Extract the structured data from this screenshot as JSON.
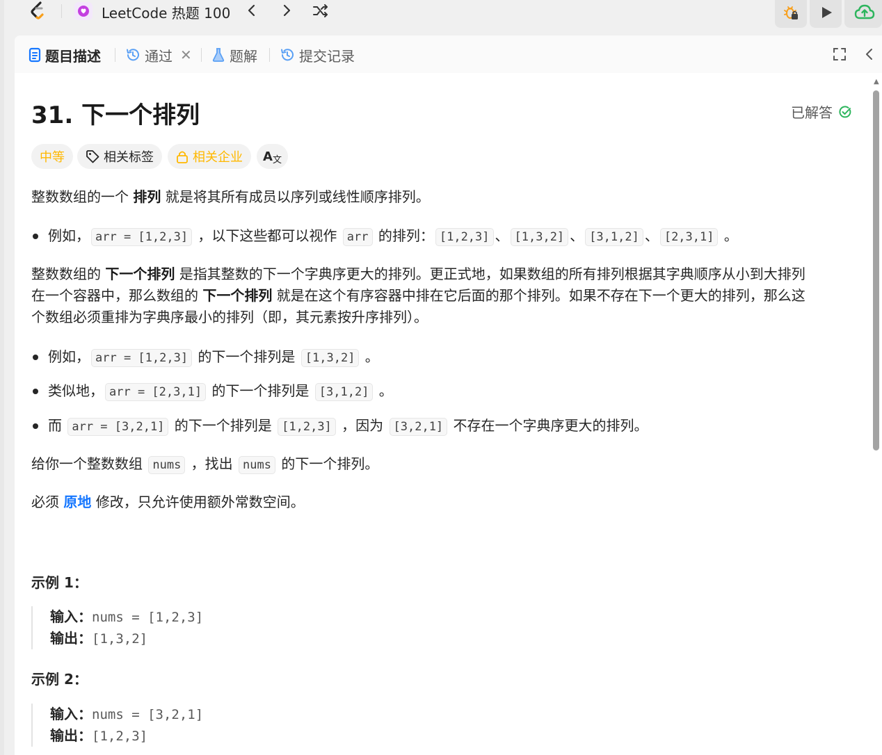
{
  "topbar": {
    "list_title": "LeetCode 热题 100"
  },
  "tabs": {
    "description": "题目描述",
    "accepted": "通过",
    "accepted_close": "✕",
    "solutions": "题解",
    "submissions": "提交记录"
  },
  "problem": {
    "title": "31. 下一个排列",
    "status": "已解答",
    "difficulty": "中等",
    "related_tags": "相关标签",
    "related_companies": "相关企业",
    "translate": "A"
  },
  "description": {
    "p1_a": "整数数组的一个 ",
    "p1_b": "排列",
    "p1_c": "  就是将其所有成员以序列或线性顺序排列。",
    "b1_a": "例如，",
    "b1_code1": "arr = [1,2,3]",
    "b1_b": " ，以下这些都可以视作 ",
    "b1_code2": "arr",
    "b1_c": " 的排列：",
    "b1_code3": "[1,2,3]",
    "b1_sep1": "、",
    "b1_code4": "[1,3,2]",
    "b1_sep2": "、",
    "b1_code5": "[3,1,2]",
    "b1_sep3": "、",
    "b1_code6": "[2,3,1]",
    "b1_end": " 。",
    "p2_l1_a": "整数数组的 ",
    "p2_l1_b": "下一个排列",
    "p2_l1_c": " 是指其整数的下一个字典序更大的排列。更正式地，如果数组的所有排列根据其字典顺序从小到大排列",
    "p2_l2_a": "在一个容器中，那么数组的 ",
    "p2_l2_b": "下一个排列",
    "p2_l2_c": " 就是在这个有序容器中排在它后面的那个排列。如果不存在下一个更大的排列，那么这",
    "p2_l3": "个数组必须重排为字典序最小的排列（即，其元素按升序排列）。",
    "b2_a": "例如，",
    "b2_code1": "arr = [1,2,3]",
    "b2_b": " 的下一个排列是 ",
    "b2_code2": "[1,3,2]",
    "b2_end": " 。",
    "b3_a": "类似地，",
    "b3_code1": "arr = [2,3,1]",
    "b3_b": " 的下一个排列是 ",
    "b3_code2": "[3,1,2]",
    "b3_end": " 。",
    "b4_a": "而 ",
    "b4_code1": "arr = [3,2,1]",
    "b4_b": " 的下一个排列是 ",
    "b4_code2": "[1,2,3]",
    "b4_c": " ，因为 ",
    "b4_code3": "[3,2,1]",
    "b4_d": " 不存在一个字典序更大的排列。",
    "p3_a": "给你一个整数数组 ",
    "p3_code1": "nums",
    "p3_b": " ，找出 ",
    "p3_code2": "nums",
    "p3_c": " 的下一个排列。",
    "p4_a": "必须 ",
    "p4_b": "原地",
    "p4_c": " 修改，只允许使用额外常数空间。"
  },
  "examples": [
    {
      "title": "示例 1：",
      "input_label": "输入：",
      "input": "nums = [1,2,3]",
      "output_label": "输出：",
      "output": "[1,3,2]"
    },
    {
      "title": "示例 2：",
      "input_label": "输入：",
      "input": "nums = [3,2,1]",
      "output_label": "输出：",
      "output": "[1,2,3]"
    }
  ],
  "colors": {
    "difficulty_medium": "#ffb800",
    "accent_blue": "#1677ff",
    "solved_green": "#2db55d",
    "run_green": "#2db55d"
  }
}
